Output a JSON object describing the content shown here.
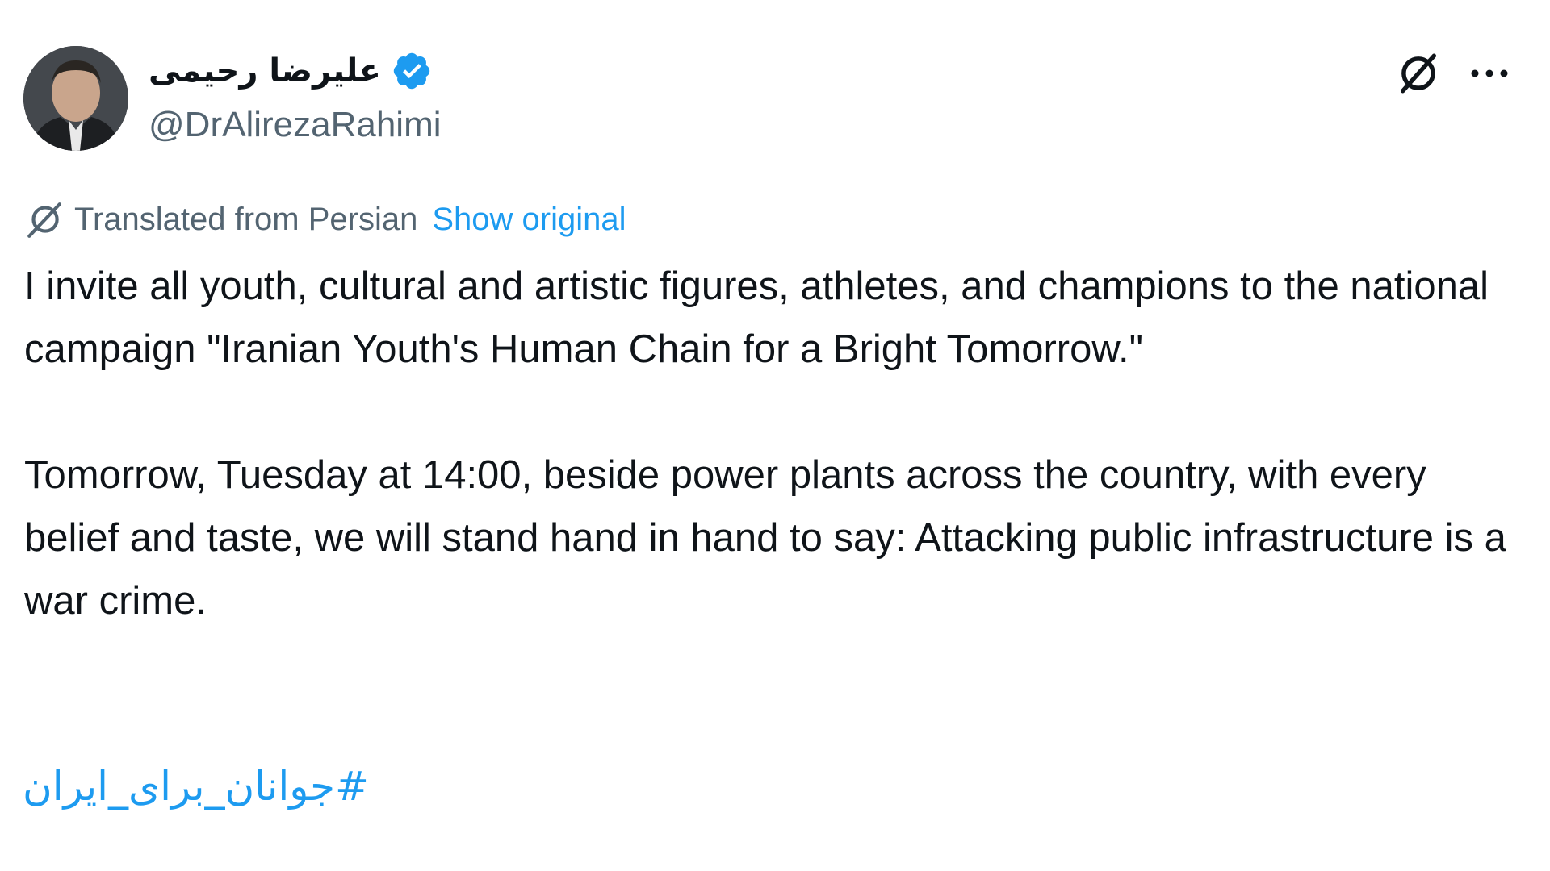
{
  "author": {
    "display_name": "علیرضا رحیمی",
    "handle": "@DrAlirezaRahimi",
    "verified": true,
    "avatar_icon": "person-portrait"
  },
  "header_actions": {
    "grok_icon": "grok-icon",
    "more_icon": "more-horizontal-icon"
  },
  "translation": {
    "label": "Translated from Persian",
    "show_original": "Show original",
    "icon": "translate-icon"
  },
  "tweet": {
    "paragraph_1": "I invite all youth, cultural and artistic figures, athletes, and champions to the national campaign \"Iranian Youth's Human Chain for a Bright Tomorrow.\"",
    "paragraph_2": "Tomorrow, Tuesday at 14:00, beside power plants across the country, with every belief and taste, we will stand hand in hand to say: Attacking public infrastructure is a war crime.",
    "hashtag": "#جوانان_برای_ایران"
  },
  "colors": {
    "text_primary": "#0f1419",
    "text_secondary": "#536471",
    "accent_blue": "#1d9bf0",
    "background": "#ffffff"
  }
}
